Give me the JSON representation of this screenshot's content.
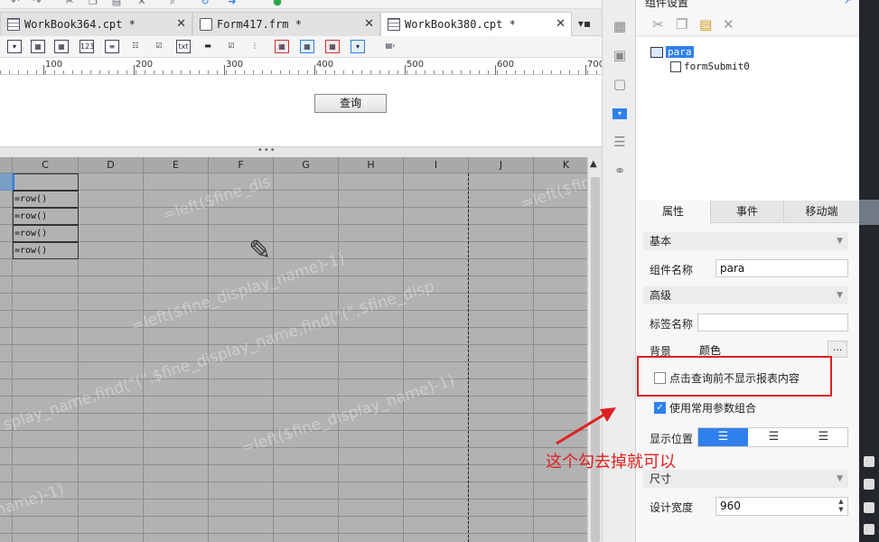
{
  "tabs": [
    {
      "label": "WorkBook364.cpt *",
      "icon": "workbook-icon",
      "active": false
    },
    {
      "label": "Form417.frm *",
      "icon": "form-icon",
      "active": false
    },
    {
      "label": "WorkBook380.cpt *",
      "icon": "workbook-icon",
      "active": true
    }
  ],
  "ruler": {
    "ticks": [
      "100",
      "200",
      "300",
      "400",
      "500",
      "600",
      "700"
    ]
  },
  "param_pane": {
    "query_button": "查询"
  },
  "grid": {
    "columns": [
      "C",
      "D",
      "E",
      "F",
      "G",
      "H",
      "I",
      "J",
      "K"
    ],
    "cells": [
      "=row()",
      "=row()",
      "=row()",
      "=row()"
    ],
    "watermarks": [
      "=left($fine_dis",
      "=left($fine_display_name)-1)",
      "splay_name,find(\"(\",$fine_display_name,find(\"(\",$fine_disp",
      "=left($fine_display_name)-1)",
      "name)-1)",
      "=left($fin"
    ]
  },
  "right_panel": {
    "title": "组件设置",
    "tree": {
      "root": "para",
      "child": "formSubmit0"
    },
    "prop_tabs": [
      "属性",
      "事件",
      "移动端"
    ],
    "sections": {
      "basic": "基本",
      "advanced": "高级",
      "size": "尺寸"
    },
    "fields": {
      "name_label": "组件名称",
      "name_value": "para",
      "tag_label": "标签名称",
      "tag_value": "",
      "bg_label": "背景",
      "bg_value": "颜色",
      "bg_more": "...",
      "hide_before_query": "点击查询前不显示报表内容",
      "hide_before_query_checked": false,
      "use_param_combo": "使用常用参数组合",
      "use_param_combo_checked": true,
      "position_label": "显示位置",
      "position_selected": "left",
      "width_label": "设计宽度",
      "width_value": "960"
    }
  },
  "annotation": {
    "text": "这个勾去掉就可以",
    "color": "#e02020"
  },
  "colors": {
    "accent": "#2f80ed",
    "annotation": "#e02020"
  }
}
